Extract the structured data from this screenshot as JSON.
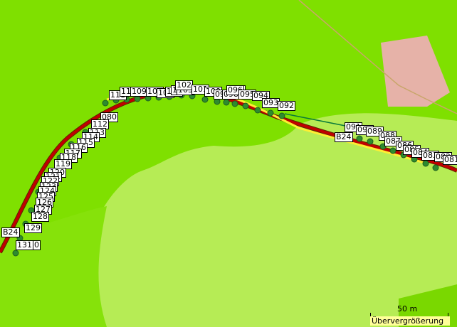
{
  "map": {
    "colors": {
      "meadow": "#7fe000",
      "field": "#b8ee5a",
      "forest_edge": "#93e21a",
      "building": "#e6b2a8",
      "track": "#c00000",
      "track_outline": "#8a3a00",
      "route_yellow": "#ffee33",
      "waypoint": "#2e8b2e",
      "dots": "#3a7a3a"
    },
    "waypoint_labels": [
      "111",
      "110",
      "109",
      "107",
      "106",
      "105",
      "104",
      "103",
      "102",
      "101",
      "100",
      "099",
      "098",
      "097",
      "096",
      "095",
      "094",
      "093",
      "092",
      "091",
      "090",
      "089",
      "088",
      "087",
      "086",
      "085",
      "084",
      "083",
      "082",
      "081",
      "080",
      "112",
      "113",
      "114",
      "115",
      "116",
      "117",
      "118",
      "119",
      "120",
      "121",
      "122",
      "123",
      "124",
      "125",
      "126",
      "127",
      "128",
      "129",
      "130",
      "131"
    ],
    "track_markers": [
      "B24",
      "B24"
    ]
  },
  "scale": {
    "label": "50 m"
  },
  "warning": {
    "text": "Übervergrößerung"
  }
}
